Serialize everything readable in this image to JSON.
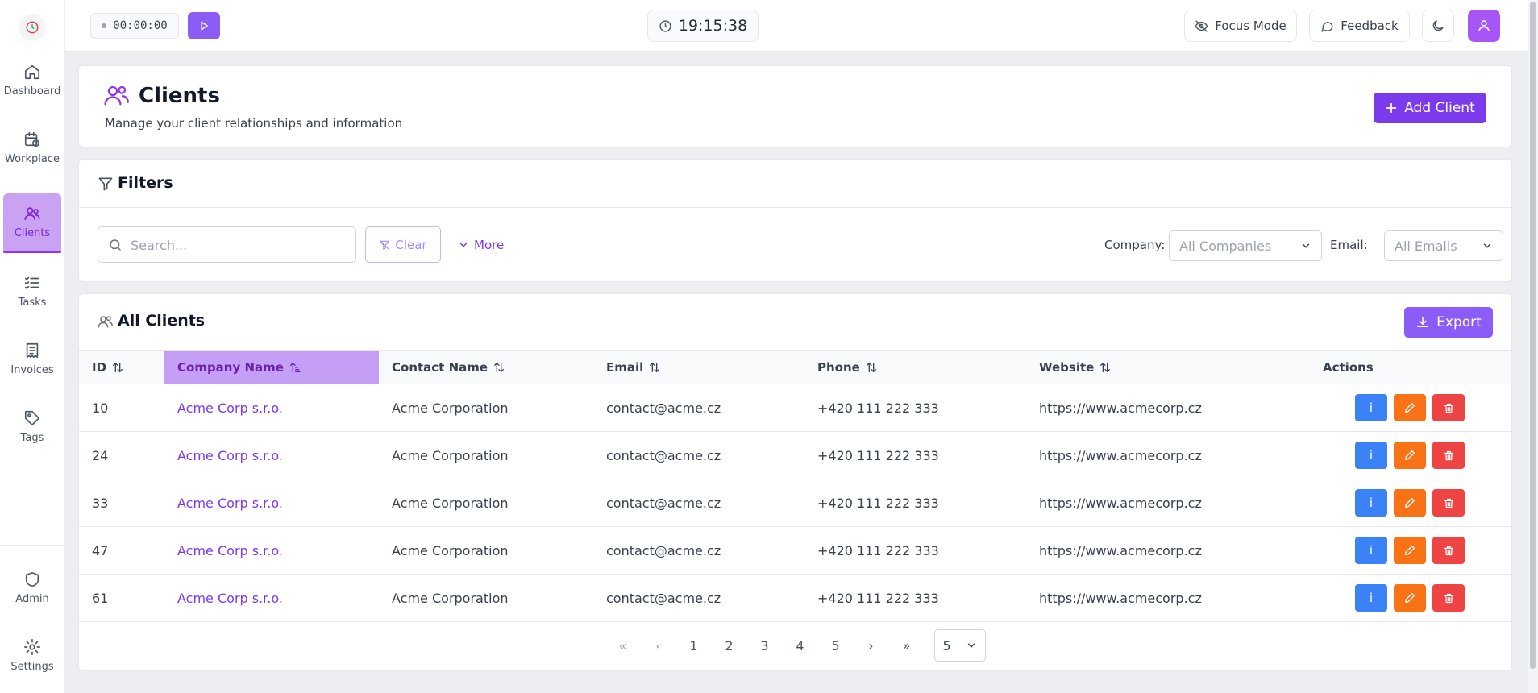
{
  "sidebar": {
    "items": [
      {
        "label": "Dashboard",
        "icon": "home-icon"
      },
      {
        "label": "Workplace",
        "icon": "calendar-icon"
      },
      {
        "label": "Clients",
        "icon": "users-icon",
        "active": true
      },
      {
        "label": "Tasks",
        "icon": "list-icon"
      },
      {
        "label": "Invoices",
        "icon": "receipt-icon"
      },
      {
        "label": "Tags",
        "icon": "tag-icon"
      }
    ],
    "bottom_items": [
      {
        "label": "Admin",
        "icon": "shield-icon"
      },
      {
        "label": "Settings",
        "icon": "gear-icon"
      }
    ]
  },
  "topbar": {
    "timer": "00:00:00",
    "clock": "19:15:38",
    "focus_mode": "Focus Mode",
    "feedback": "Feedback"
  },
  "header": {
    "title": "Clients",
    "subtitle": "Manage your client relationships and information",
    "add_button": "Add Client"
  },
  "filters": {
    "title": "Filters",
    "search_placeholder": "Search...",
    "clear": "Clear",
    "more": "More",
    "company_label": "Company:",
    "company_value": "All Companies",
    "email_label": "Email:",
    "email_value": "All Emails"
  },
  "table": {
    "title": "All Clients",
    "export": "Export",
    "columns": [
      "ID",
      "Company Name",
      "Contact Name",
      "Email",
      "Phone",
      "Website",
      "Actions"
    ],
    "rows": [
      {
        "id": "10",
        "company": "Acme Corp s.r.o.",
        "contact": "Acme Corporation",
        "email": "contact@acme.cz",
        "phone": "+420 111 222 333",
        "website": "https://www.acmecorp.cz"
      },
      {
        "id": "24",
        "company": "Acme Corp s.r.o.",
        "contact": "Acme Corporation",
        "email": "contact@acme.cz",
        "phone": "+420 111 222 333",
        "website": "https://www.acmecorp.cz"
      },
      {
        "id": "33",
        "company": "Acme Corp s.r.o.",
        "contact": "Acme Corporation",
        "email": "contact@acme.cz",
        "phone": "+420 111 222 333",
        "website": "https://www.acmecorp.cz"
      },
      {
        "id": "47",
        "company": "Acme Corp s.r.o.",
        "contact": "Acme Corporation",
        "email": "contact@acme.cz",
        "phone": "+420 111 222 333",
        "website": "https://www.acmecorp.cz"
      },
      {
        "id": "61",
        "company": "Acme Corp s.r.o.",
        "contact": "Acme Corporation",
        "email": "contact@acme.cz",
        "phone": "+420 111 222 333",
        "website": "https://www.acmecorp.cz"
      }
    ],
    "info_label": "i"
  },
  "pagination": {
    "first": "«",
    "prev": "‹",
    "pages": [
      "1",
      "2",
      "3",
      "4",
      "5"
    ],
    "next": "›",
    "last": "»",
    "page_size": "5"
  },
  "colors": {
    "accent": "#7c3aed",
    "active_nav": "#c9a2f4",
    "info": "#3b82f6",
    "edit": "#f97316",
    "delete": "#ef4444"
  }
}
